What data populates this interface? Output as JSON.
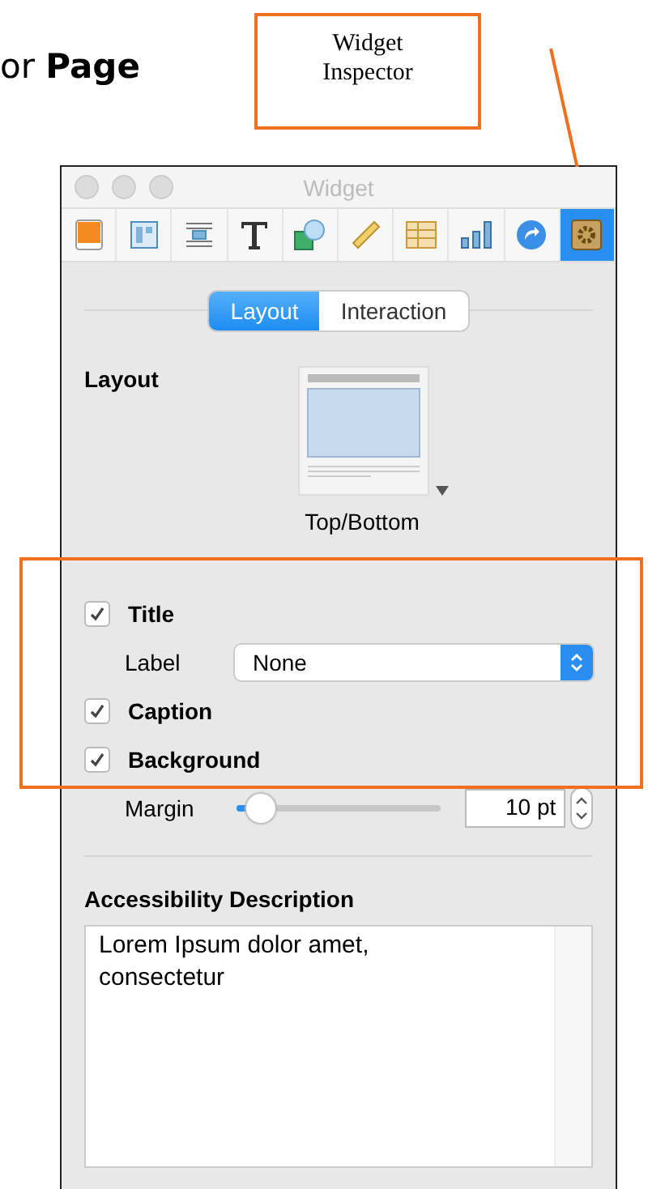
{
  "heading": "or **Page**",
  "callout": {
    "text": "Widget Inspector"
  },
  "window": {
    "title": "Widget"
  },
  "toolbar": [
    {
      "kind": "color",
      "selected": false
    },
    {
      "kind": "layout",
      "selected": false
    },
    {
      "kind": "wrap",
      "selected": false
    },
    {
      "kind": "text",
      "selected": false
    },
    {
      "kind": "shape",
      "selected": false
    },
    {
      "kind": "ruler",
      "selected": false
    },
    {
      "kind": "table",
      "selected": false
    },
    {
      "kind": "chart",
      "selected": false
    },
    {
      "kind": "action",
      "selected": false
    },
    {
      "kind": "settings",
      "selected": true
    }
  ],
  "tabs": [
    {
      "label": "Layout",
      "selected": true
    },
    {
      "label": "Interaction",
      "selected": false
    }
  ],
  "layout": {
    "label": "Layout",
    "caption": "Top/Bottom"
  },
  "options": [
    {
      "kind": "checkbox",
      "label": "Title",
      "checked": true
    },
    {
      "kind": "popup",
      "label": "Label",
      "value": "None"
    },
    {
      "kind": "checkbox",
      "label": "Caption",
      "checked": true
    },
    {
      "kind": "checkbox",
      "label": "Background",
      "checked": true
    },
    {
      "kind": "slider",
      "label": "Margin",
      "level": 0.12,
      "value": "10 pt"
    }
  ],
  "description": {
    "label": "Accessibility Description",
    "value": "Lorem Ipsum dolor amet, consectetur"
  }
}
